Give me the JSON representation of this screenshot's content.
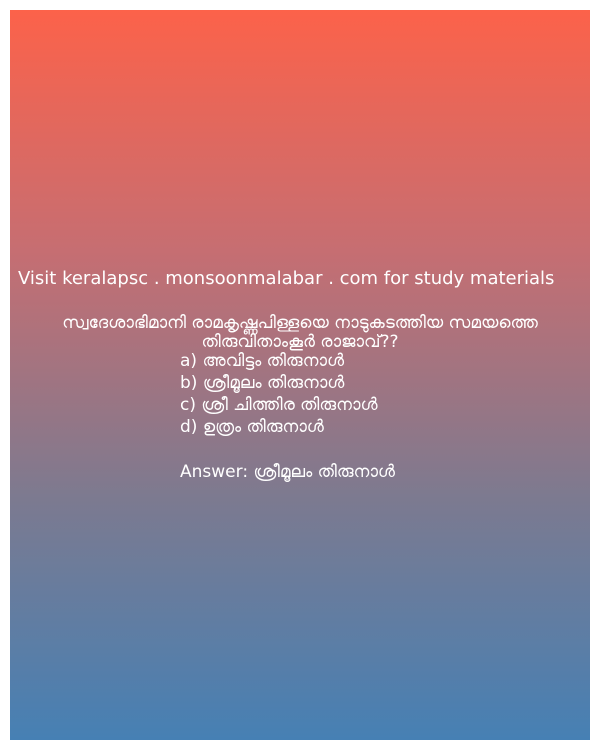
{
  "site_line": "Visit keralapsc . monsoonmalabar . com for study materials",
  "question": {
    "line1": "സ്വദേശാഭിമാനി രാമകൃഷ്ണപിള്ളയെ നാടുകടത്തിയ സമയത്തെ",
    "line2": "തിരുവിതാംകൂർ രാജാവ്??"
  },
  "options": [
    "a) അവിട്ടം തിരുനാൾ",
    "b) ശ്രീമൂലം തിരുനാൾ",
    "c) ശ്രീ ചിത്തിര തിരുനാൾ",
    "d) ഉത്രം തിരുനാൾ"
  ],
  "answer": "Answer: ശ്രീമൂലം തിരുനാൾ",
  "colors": {
    "gradient_top": "#fc624a",
    "gradient_bottom": "#4680b4",
    "text": "#ffffff"
  }
}
